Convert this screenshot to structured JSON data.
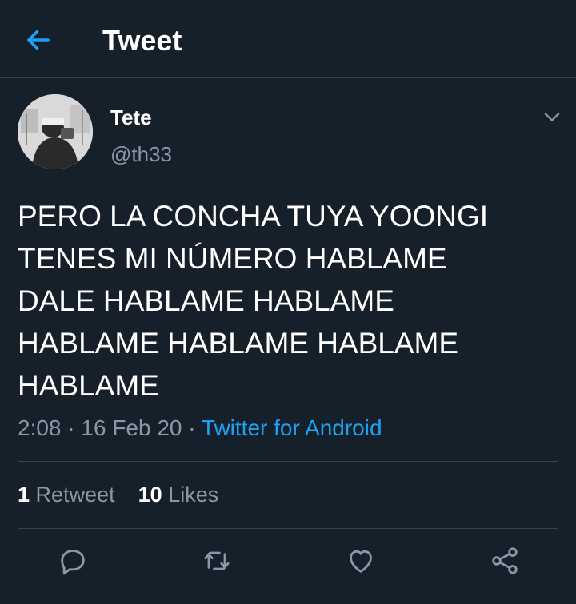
{
  "header": {
    "title": "Tweet",
    "back_icon": "arrow-left-icon"
  },
  "tweet": {
    "display_name": "Tete",
    "handle": "@th33",
    "text_lines": [
      "PERO LA CONCHA TUYA YOONGI",
      "TENES MI NÚMERO HABLAME",
      "DALE HABLAME HABLAME",
      "HABLAME HABLAME HABLAME",
      "HABLAME"
    ],
    "time": "2:08",
    "separator": "·",
    "date": "16 Feb 20",
    "source": "Twitter for Android"
  },
  "stats": {
    "retweets_count": "1",
    "retweets_label": "Retweet",
    "likes_count": "10",
    "likes_label": "Likes"
  },
  "actions": {
    "reply_icon": "reply-icon",
    "retweet_icon": "retweet-icon",
    "like_icon": "heart-icon",
    "share_icon": "share-icon"
  },
  "colors": {
    "background": "#15202b",
    "accent": "#1da1f2",
    "secondary_text": "#8899a6",
    "divider": "#38444d"
  }
}
